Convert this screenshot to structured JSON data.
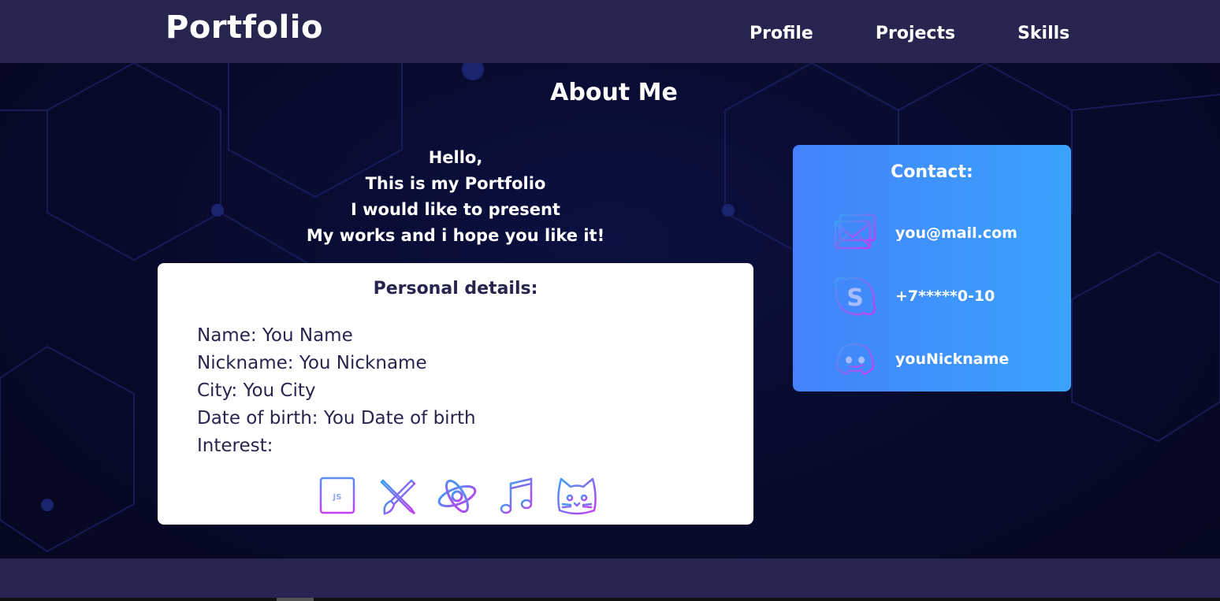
{
  "header": {
    "logo": "Portfolio",
    "nav": [
      "Profile",
      "Projects",
      "Skills"
    ]
  },
  "about": {
    "title": "About Me",
    "intro": [
      "Hello,",
      "This is my Portfolio",
      "I would like to present",
      "My works and i hope you like it!"
    ]
  },
  "personal_details": {
    "title": "Personal details:",
    "rows": [
      "Name: You Name",
      "Nickname: You Nickname",
      "City: You City",
      "Date of birth: You Date of birth",
      "Interest:"
    ],
    "interest_icons": [
      "javascript-file-icon",
      "pencil-brush-tools-icon",
      "battlenet-icon",
      "music-note-icon",
      "cat-face-icon"
    ],
    "js_icon_label": "JS"
  },
  "contact": {
    "title": "Contact:",
    "items": [
      {
        "icon": "envelope-icon",
        "text": "you@mail.com"
      },
      {
        "icon": "skype-icon",
        "text": "+7*****0-10"
      },
      {
        "icon": "discord-icon",
        "text": "youNickname"
      }
    ]
  },
  "colors": {
    "header_bg": "#27254f",
    "page_bg": "#070a2b",
    "card_bg": "#ffffff",
    "card_text": "#27254f",
    "contact_gradient_start": "#4382fb",
    "contact_gradient_end": "#3aa3fb",
    "icon_gradient_start": "#3aa0f5",
    "icon_gradient_end": "#c33ef0"
  }
}
